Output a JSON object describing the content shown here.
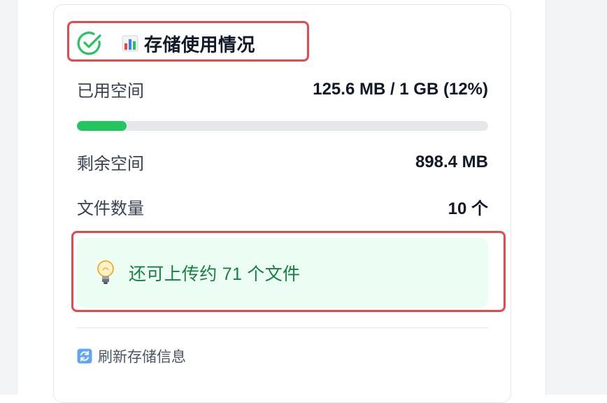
{
  "card": {
    "header": {
      "status_icon": "check-circle-icon",
      "chart_icon": "bar-chart-icon",
      "title": "存储使用情况"
    },
    "used": {
      "label": "已用空间",
      "value": "125.6 MB / 1 GB (12%)"
    },
    "usage_progress": {
      "percent": 12,
      "color": "#22c55e"
    },
    "remaining": {
      "label": "剩余空间",
      "value": "898.4 MB"
    },
    "file_count": {
      "label": "文件数量",
      "value": "10 个"
    },
    "tip": {
      "icon": "lightbulb-icon",
      "text": "还可上传约 71 个文件",
      "color": "#15803d",
      "background": "#ecfdf3"
    },
    "refresh": {
      "icon": "refresh-icon",
      "label": "刷新存储信息"
    }
  },
  "highlight_color": "#e5484d"
}
